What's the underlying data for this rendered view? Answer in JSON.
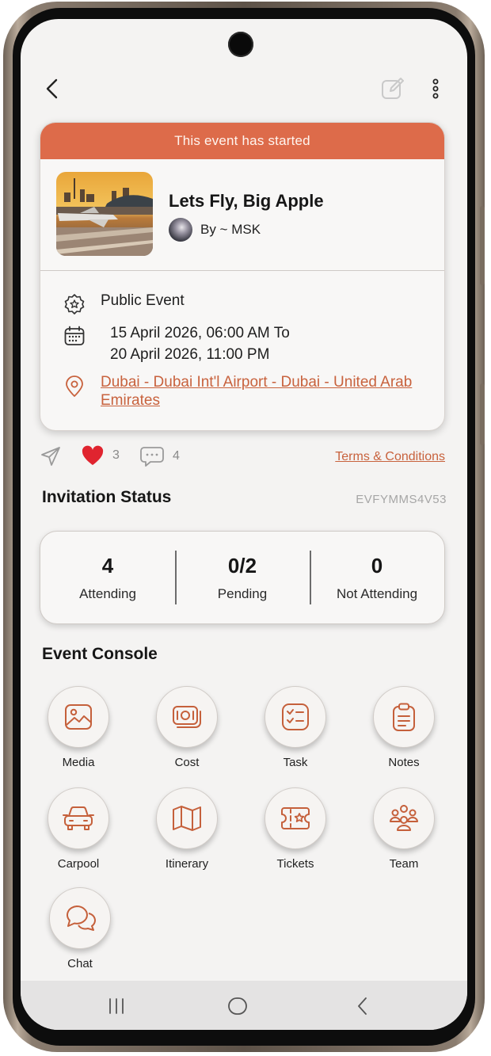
{
  "colors": {
    "accent": "#dd6b4a",
    "link": "#c8623d",
    "heart": "#e0242f",
    "icon_stroke": "#c5603b"
  },
  "header": {
    "back_icon": "chevron-left-icon",
    "edit_icon": "edit-icon",
    "more_icon": "more-vertical-icon"
  },
  "event": {
    "status_banner": "This event has started",
    "title": "Lets Fly, Big Apple",
    "organizer": "By ~ MSK",
    "type": "Public Event",
    "date_line1": "15 April 2026, 06:00 AM To",
    "date_line2": "20 April 2026, 11:00 PM",
    "location": "Dubai - Dubai Int'l Airport - Dubai - United Arab Emirates"
  },
  "actions": {
    "likes": "3",
    "comments": "4",
    "terms": "Terms & Conditions"
  },
  "invitation": {
    "title": "Invitation Status",
    "code": "EVFYMMS4V53",
    "stats": [
      {
        "value": "4",
        "label": "Attending"
      },
      {
        "value": "0/2",
        "label": "Pending"
      },
      {
        "value": "0",
        "label": "Not Attending"
      }
    ]
  },
  "console": {
    "title": "Event Console",
    "items": [
      {
        "label": "Media",
        "icon": "image-icon"
      },
      {
        "label": "Cost",
        "icon": "money-icon"
      },
      {
        "label": "Task",
        "icon": "checklist-icon"
      },
      {
        "label": "Notes",
        "icon": "clipboard-icon"
      },
      {
        "label": "Carpool",
        "icon": "car-icon"
      },
      {
        "label": "Itinerary",
        "icon": "map-icon"
      },
      {
        "label": "Tickets",
        "icon": "ticket-icon"
      },
      {
        "label": "Team",
        "icon": "team-icon"
      },
      {
        "label": "Chat",
        "icon": "chat-icon"
      }
    ]
  },
  "navbar": {
    "recents_icon": "recents-icon",
    "home_icon": "home-icon",
    "back_icon": "back-icon"
  }
}
